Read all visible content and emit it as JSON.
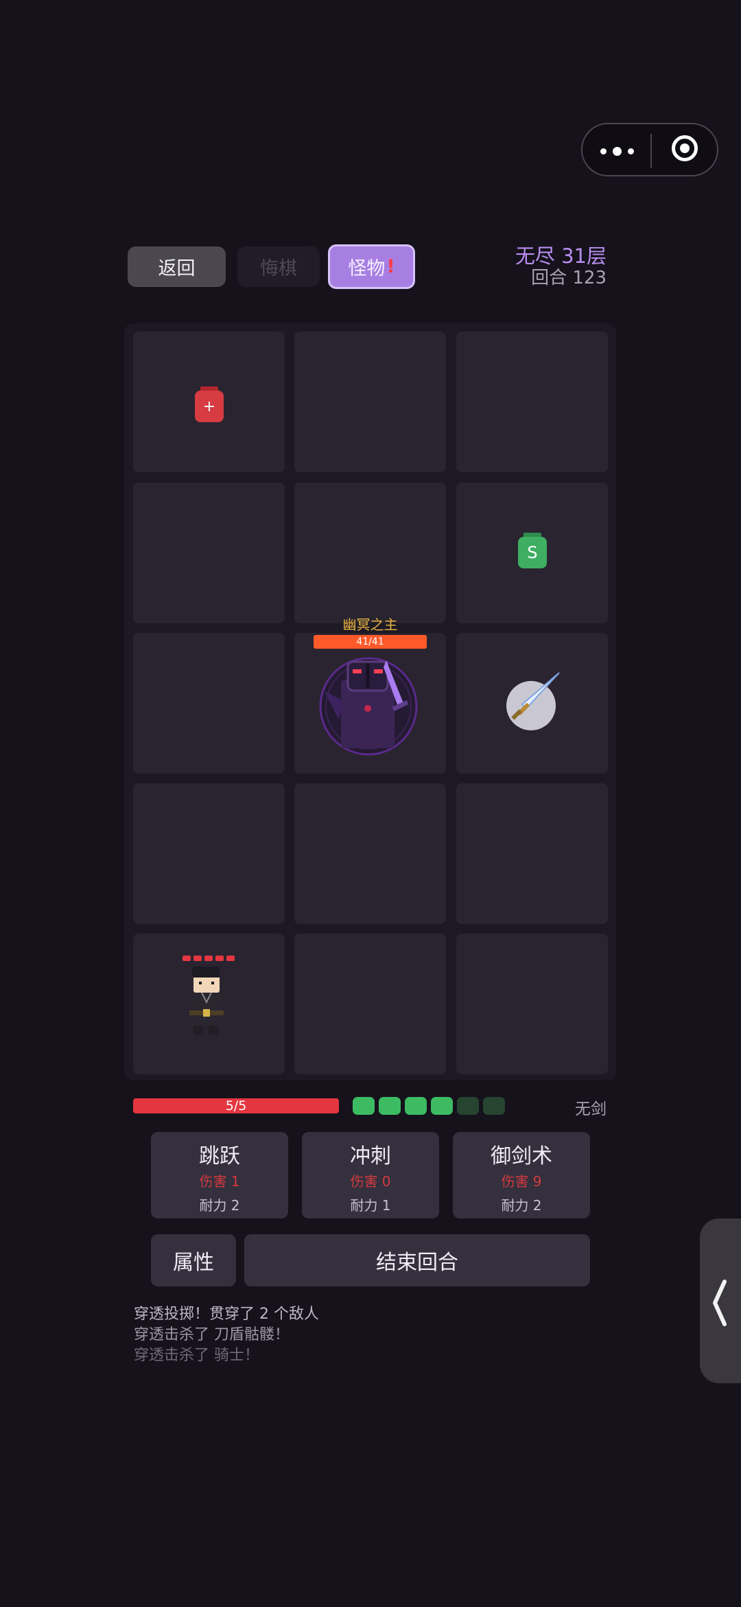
{
  "topbar": {
    "back_label": "返回",
    "undo_label": "悔棋",
    "monster_label": "怪物",
    "monster_alert": "!",
    "floor_text": "无尽 31层",
    "turn_text": "回合 123"
  },
  "board": {
    "potion_red_symbol": "+",
    "potion_green_symbol": "S",
    "boss_name": "幽冥之主",
    "boss_hp": "41/41"
  },
  "player": {
    "hp_text": "5/5",
    "stamina_total": 6,
    "stamina_filled": 4,
    "sword_status": "无剑"
  },
  "skills": [
    {
      "name": "跳跃",
      "damage": "伤害 1",
      "cost": "耐力 2"
    },
    {
      "name": "冲刺",
      "damage": "伤害 0",
      "cost": "耐力 1"
    },
    {
      "name": "御剑术",
      "damage": "伤害 9",
      "cost": "耐力 2"
    }
  ],
  "actions": {
    "attr_label": "属性",
    "end_turn_label": "结束回合"
  },
  "log": [
    "穿透投掷！贯穿了 2 个敌人",
    "穿透击杀了 刀盾骷髅！",
    "穿透击杀了 骑士！"
  ],
  "colors": {
    "accent_purple": "#a77fe2",
    "hp_red": "#e33640",
    "stamina_full": "#3dbb63",
    "stamina_empty": "#26442f",
    "boss_name": "#e9b340"
  }
}
